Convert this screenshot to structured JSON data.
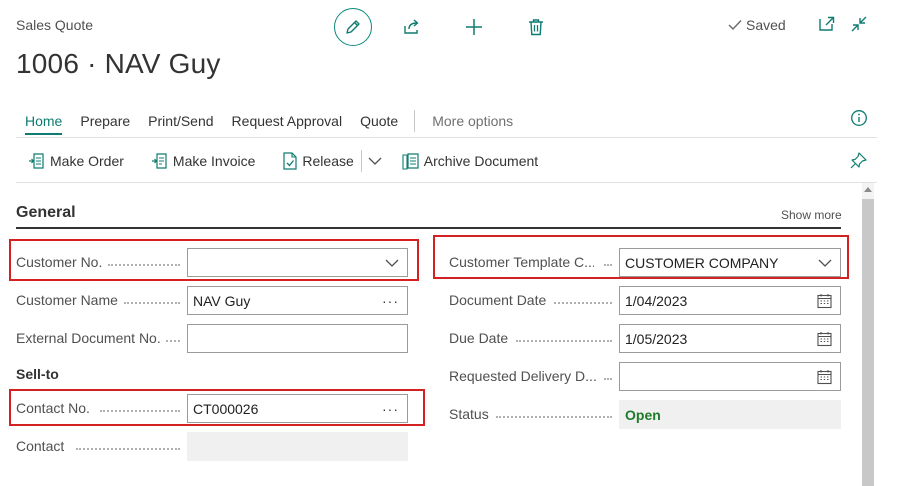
{
  "header": {
    "page_type": "Sales Quote",
    "title": "1006 · NAV Guy",
    "saved_label": "Saved"
  },
  "tabs": [
    {
      "label": "Home"
    },
    {
      "label": "Prepare"
    },
    {
      "label": "Print/Send"
    },
    {
      "label": "Request Approval"
    },
    {
      "label": "Quote"
    },
    {
      "label": "More options"
    }
  ],
  "actions": {
    "make_order": "Make Order",
    "make_invoice": "Make Invoice",
    "release": "Release",
    "archive_document": "Archive Document"
  },
  "general": {
    "title": "General",
    "show_more": "Show more",
    "customer_no": {
      "label": "Customer No.",
      "value": ""
    },
    "customer_name": {
      "label": "Customer Name",
      "value": "NAV Guy"
    },
    "external_doc_no": {
      "label": "External Document No.",
      "value": ""
    },
    "sell_to_heading": "Sell-to",
    "contact_no": {
      "label": "Contact No.",
      "value": "CT000026"
    },
    "contact": {
      "label": "Contact",
      "value": ""
    },
    "customer_template": {
      "label": "Customer Template C...",
      "value": "CUSTOMER COMPANY"
    },
    "document_date": {
      "label": "Document Date",
      "value": "1/04/2023"
    },
    "due_date": {
      "label": "Due Date",
      "value": "1/05/2023"
    },
    "requested_delivery": {
      "label": "Requested Delivery D...",
      "value": ""
    },
    "status": {
      "label": "Status",
      "value": "Open"
    }
  },
  "colors": {
    "accent": "#0e7c70",
    "highlight_box": "#d42222",
    "status_open": "#1f7a2c"
  }
}
